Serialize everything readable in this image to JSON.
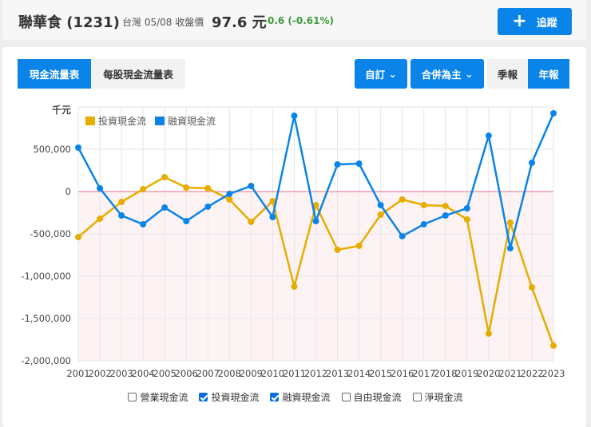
{
  "header": {
    "title": "聯華食 (1231)",
    "meta": "台灣 05/08 收盤價",
    "price": "97.6 元",
    "change": "-0.6 (-0.61%)",
    "track_label": "追蹤",
    "track_icon": "plus-icon"
  },
  "toolbar": {
    "tab_cashflow": "現金流量表",
    "tab_per_share": "每股現金流量表",
    "custom": "自訂",
    "consolidated": "合併為主",
    "quarterly": "季報",
    "annual": "年報"
  },
  "checkboxes": [
    {
      "label": "營業現金流",
      "checked": false
    },
    {
      "label": "投資現金流",
      "checked": true
    },
    {
      "label": "融資現金流",
      "checked": true
    },
    {
      "label": "自由現金流",
      "checked": false
    },
    {
      "label": "淨現金流",
      "checked": false
    }
  ],
  "chart_data": {
    "type": "line",
    "ylabel": "千元",
    "ylim": [
      -2000000,
      1000000
    ],
    "yticks": [
      500000,
      0,
      -500000,
      -1000000,
      -1500000,
      -2000000
    ],
    "ytick_labels": [
      "500,000",
      "0",
      "-500,000",
      "-1,000,000",
      "-1,500,000",
      "-2,000,000"
    ],
    "legend_position": "top-left",
    "x": [
      "2001",
      "2002",
      "2003",
      "2004",
      "2005",
      "2006",
      "2007",
      "2008",
      "2009",
      "2010",
      "2011",
      "2012",
      "2013",
      "2014",
      "2015",
      "2016",
      "2017",
      "2018",
      "2019",
      "2020",
      "2021",
      "2022",
      "2023"
    ],
    "series": [
      {
        "name": "投資現金流",
        "color": "#e6ad00",
        "values": [
          -538000,
          -321000,
          -123000,
          28000,
          170000,
          47000,
          38000,
          -94000,
          -358000,
          -113000,
          -1123000,
          -160000,
          -689000,
          -642000,
          -274000,
          -94000,
          -160000,
          -170000,
          -330000,
          -1679000,
          -368000,
          -1132000,
          -1821000
        ]
      },
      {
        "name": "融資現金流",
        "color": "#0a84e8",
        "values": [
          519000,
          38000,
          -283000,
          -387000,
          -189000,
          -349000,
          -179000,
          -28000,
          66000,
          -302000,
          896000,
          -349000,
          321000,
          330000,
          -160000,
          -528000,
          -387000,
          -283000,
          -198000,
          660000,
          -670000,
          340000,
          925000
        ]
      }
    ]
  }
}
